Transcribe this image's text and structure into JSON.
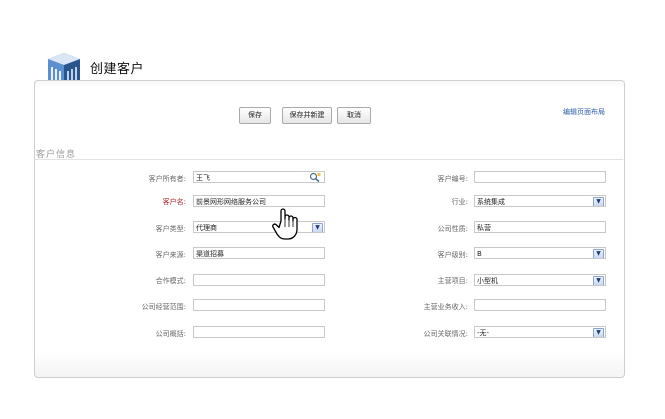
{
  "page": {
    "title": "创建客户"
  },
  "toolbar": {
    "save_label": "保存",
    "save_new_label": "保存并新建",
    "cancel_label": "取消",
    "edit_layout_label": "编辑页面布局"
  },
  "section": {
    "title": "客户信息"
  },
  "left_fields": [
    {
      "label": "客户所有者:",
      "value": "王飞",
      "required": false
    },
    {
      "label": "客户名:",
      "value": "前景网形网络服务公司",
      "required": true
    },
    {
      "label": "客户类型:",
      "value": "代理商",
      "required": false
    },
    {
      "label": "客户来源:",
      "value": "渠道招募",
      "required": false
    },
    {
      "label": "合作模式:",
      "value": "",
      "required": false
    },
    {
      "label": "公司经营范围:",
      "value": "",
      "required": false
    },
    {
      "label": "公司概括:",
      "value": "",
      "required": false
    }
  ],
  "right_fields": [
    {
      "label": "客户编号:",
      "value": ""
    },
    {
      "label": "行业:",
      "value": "系统集成"
    },
    {
      "label": "公司性质:",
      "value": "私营"
    },
    {
      "label": "客户级别:",
      "value": "B"
    },
    {
      "label": "主营项目:",
      "value": "小型机"
    },
    {
      "label": "主营业务收入:",
      "value": ""
    },
    {
      "label": "公司关联情况:",
      "value": "-无-"
    }
  ],
  "icons": {
    "app": "building-icon",
    "lookup": "lookup-icon",
    "cursor": "hand-cursor-icon",
    "dropdown": "chevron-down-icon"
  }
}
